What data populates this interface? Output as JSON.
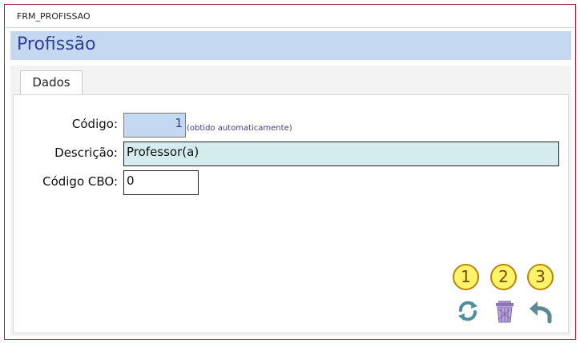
{
  "window": {
    "title": "FRM_PROFISSAO"
  },
  "header": {
    "title": "Profissão"
  },
  "tabs": [
    {
      "label": "Dados"
    }
  ],
  "form": {
    "codigo": {
      "label": "Código:",
      "value": "1",
      "hint": "(obtido automaticamente)"
    },
    "descricao": {
      "label": "Descrição:",
      "value": "Professor(a)"
    },
    "codigo_cbo": {
      "label": "Código CBO:",
      "value": "0"
    }
  },
  "buttons": [
    {
      "badge": "1",
      "icon": "refresh-icon"
    },
    {
      "badge": "2",
      "icon": "trash-icon"
    },
    {
      "badge": "3",
      "icon": "undo-icon"
    }
  ],
  "colors": {
    "frame_border": "#a8253b",
    "header_band": "#c5d8f1",
    "header_text": "#2f4396",
    "codigo_field": "#c5d8f1",
    "descricao_field": "#d4ecee",
    "badge_fill": "#fff36a"
  }
}
